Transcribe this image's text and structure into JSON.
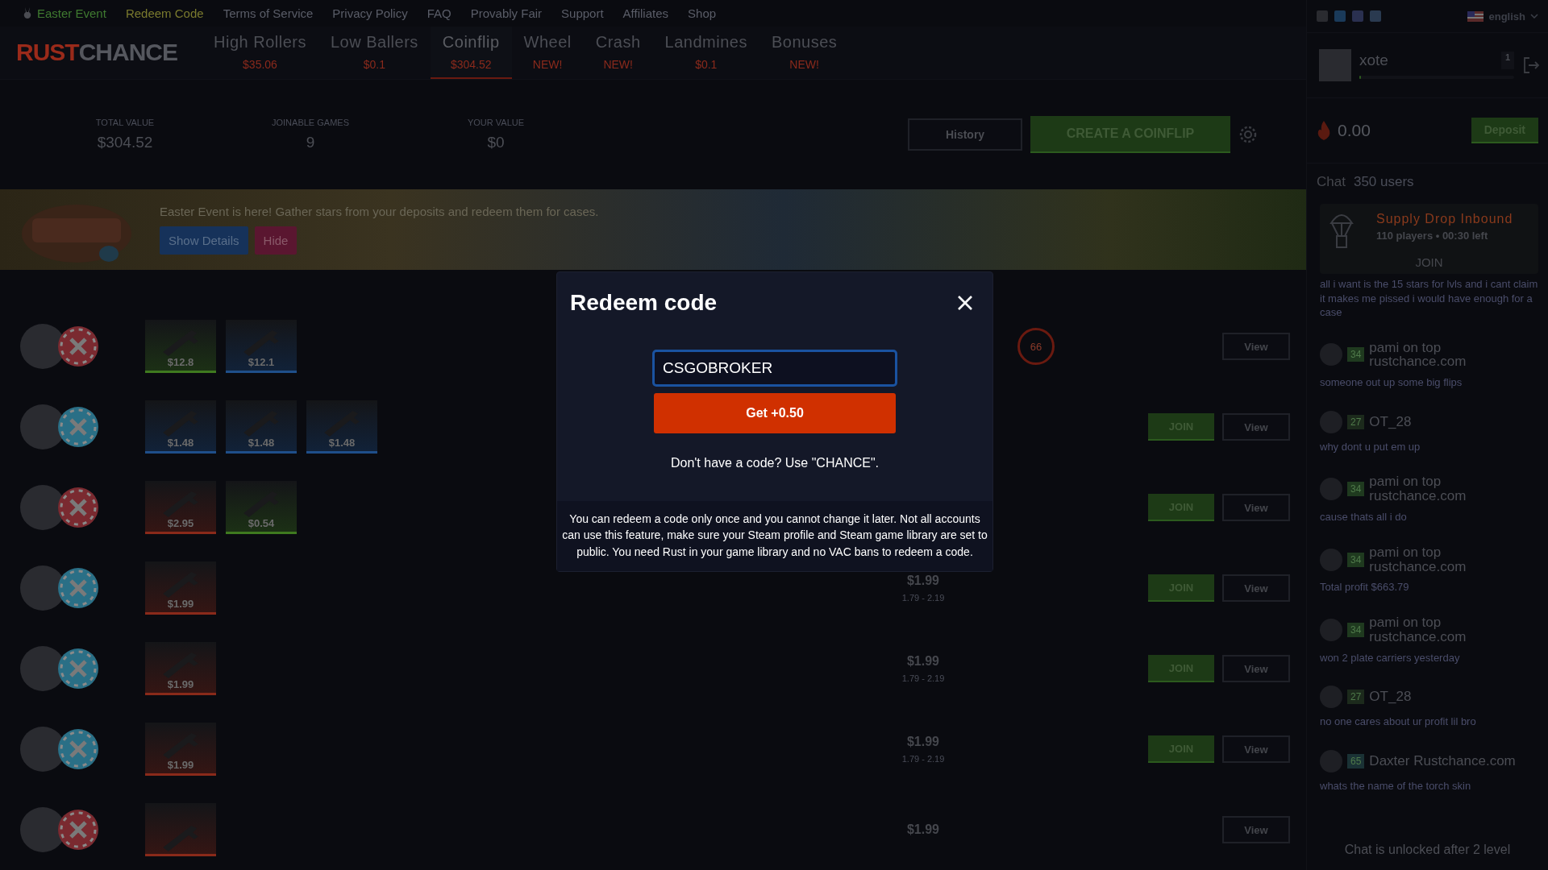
{
  "top_links": [
    {
      "label": "Easter Event",
      "color": "#3f7a30",
      "kind": "event"
    },
    {
      "label": "Redeem Code",
      "color": "#7a7a2e",
      "kind": "link"
    },
    {
      "label": "Terms of Service",
      "color": "#5a5d68",
      "kind": "link"
    },
    {
      "label": "Privacy Policy",
      "color": "#5a5d68",
      "kind": "link"
    },
    {
      "label": "FAQ",
      "color": "#5a5d68",
      "kind": "link"
    },
    {
      "label": "Provably Fair",
      "color": "#5a5d68",
      "kind": "link"
    },
    {
      "label": "Support",
      "color": "#5a5d68",
      "kind": "link"
    },
    {
      "label": "Affiliates",
      "color": "#5a5d68",
      "kind": "link"
    },
    {
      "label": "Shop",
      "color": "#5a5d68",
      "kind": "link"
    }
  ],
  "logo": {
    "part_1": "RUST",
    "part_2": "CHANCE"
  },
  "tabs": [
    {
      "label": "High Rollers",
      "sub": "$35.06",
      "selected": false
    },
    {
      "label": "Low Ballers",
      "sub": "$0.1",
      "selected": false
    },
    {
      "label": "Coinflip",
      "sub": "$304.52",
      "selected": true
    },
    {
      "label": "Wheel",
      "sub": "NEW!",
      "selected": false
    },
    {
      "label": "Crash",
      "sub": "NEW!",
      "selected": false
    },
    {
      "label": "Landmines",
      "sub": "$0.1",
      "selected": false
    },
    {
      "label": "Bonuses",
      "sub": "NEW!",
      "selected": false
    }
  ],
  "stats": [
    {
      "label": "TOTAL VALUE",
      "value": "$304.52"
    },
    {
      "label": "JOINABLE GAMES",
      "value": "9"
    },
    {
      "label": "YOUR VALUE",
      "value": "$0"
    }
  ],
  "actions": {
    "history": "History",
    "create": "CREATE A COINFLIP"
  },
  "banner": {
    "text": "Easter Event is here! Gather stars from your deposits and redeem them for cases.",
    "details": "Show Details",
    "hide": "Hide"
  },
  "games": [
    {
      "color": "#7a2a30",
      "items": [
        {
          "price": "$12.8",
          "color": "#3f7a1f"
        },
        {
          "price": "$12.1",
          "color": "#1f4f8a"
        }
      ],
      "timer": "66",
      "view": "View"
    },
    {
      "color": "#2a6f86",
      "items": [
        {
          "price": "$1.48",
          "color": "#1f4f8a"
        },
        {
          "price": "$1.48",
          "color": "#1f4f8a"
        },
        {
          "price": "$1.48",
          "color": "#1f4f8a"
        }
      ],
      "join_label": "JOIN",
      "view": "View"
    },
    {
      "color": "#7a2a30",
      "items": [
        {
          "price": "$2.95",
          "color": "#8a2a1a"
        },
        {
          "price": "$0.54",
          "color": "#3f7a1f"
        }
      ],
      "join_label": "JOIN",
      "view": "View"
    },
    {
      "color": "#2a6f86",
      "items": [
        {
          "price": "$1.99",
          "color": "#8a2a1a"
        }
      ],
      "value": "$1.99",
      "range": "1.79 - 2.19",
      "join_label": "JOIN",
      "view": "View"
    },
    {
      "color": "#2a6f86",
      "items": [
        {
          "price": "$1.99",
          "color": "#8a2a1a"
        }
      ],
      "value": "$1.99",
      "range": "1.79 - 2.19",
      "join_label": "JOIN",
      "view": "View"
    },
    {
      "color": "#2a6f86",
      "items": [
        {
          "price": "$1.99",
          "color": "#8a2a1a"
        }
      ],
      "value": "$1.99",
      "range": "1.79 - 2.19",
      "join_label": "JOIN",
      "view": "View"
    },
    {
      "color": "#7a2a30",
      "items": [
        {
          "color": "#8a2a1a"
        }
      ],
      "value": "$1.99",
      "view": "View"
    }
  ],
  "sidebar": {
    "language": "english",
    "user": {
      "name": "xote",
      "level": "1",
      "progress": {
        "level": 0
      }
    },
    "balance": "0.00",
    "deposit": "Deposit",
    "chat_title": "Chat",
    "users": "350 users",
    "drop": {
      "title": "Supply Drop Inbound",
      "info": "110 players • 00:30 left",
      "join": "JOIN"
    },
    "messages": [
      {
        "text": "all i want is the 15 stars for lvls and i cant claim it makes me pissed i would have enough for a case"
      },
      {
        "level": "34",
        "color": "#1f3a1f",
        "name": "pami on top rustchance.com",
        "text": "someone out up some big flips"
      },
      {
        "level": "27",
        "color": "#1c2a1c",
        "name": "OT_28",
        "text": "why dont u put em up"
      },
      {
        "level": "34",
        "color": "#1f3a1f",
        "name": "pami on top rustchance.com",
        "text": "cause thats all i do"
      },
      {
        "level": "34",
        "color": "#1f3a1f",
        "name": "pami on top rustchance.com",
        "text": "Total profit $663.79"
      },
      {
        "level": "34",
        "color": "#1f3a1f",
        "name": "pami on top rustchance.com",
        "text": "won 2 plate carriers yesterday"
      },
      {
        "level": "27",
        "color": "#1c2a1c",
        "name": "OT_28",
        "text": "no one cares about ur profit lil bro"
      },
      {
        "level": "65",
        "color": "#1a3235",
        "name": "Daxter Rustchance.com",
        "text": "whats the name of the torch skin"
      }
    ],
    "locked": "Chat is unlocked after 2 level"
  },
  "modal": {
    "title": "Redeem code",
    "code": "CSGOBROKER",
    "submit": "Get +0.50",
    "hint": "Don't have a code? Use \"CHANCE\".",
    "note": "You can redeem a code only once and you cannot change it later. Not all accounts can use this feature, make sure your Steam profile and Steam game library are set to public. You need Rust in your game library and no VAC bans to redeem a code."
  }
}
